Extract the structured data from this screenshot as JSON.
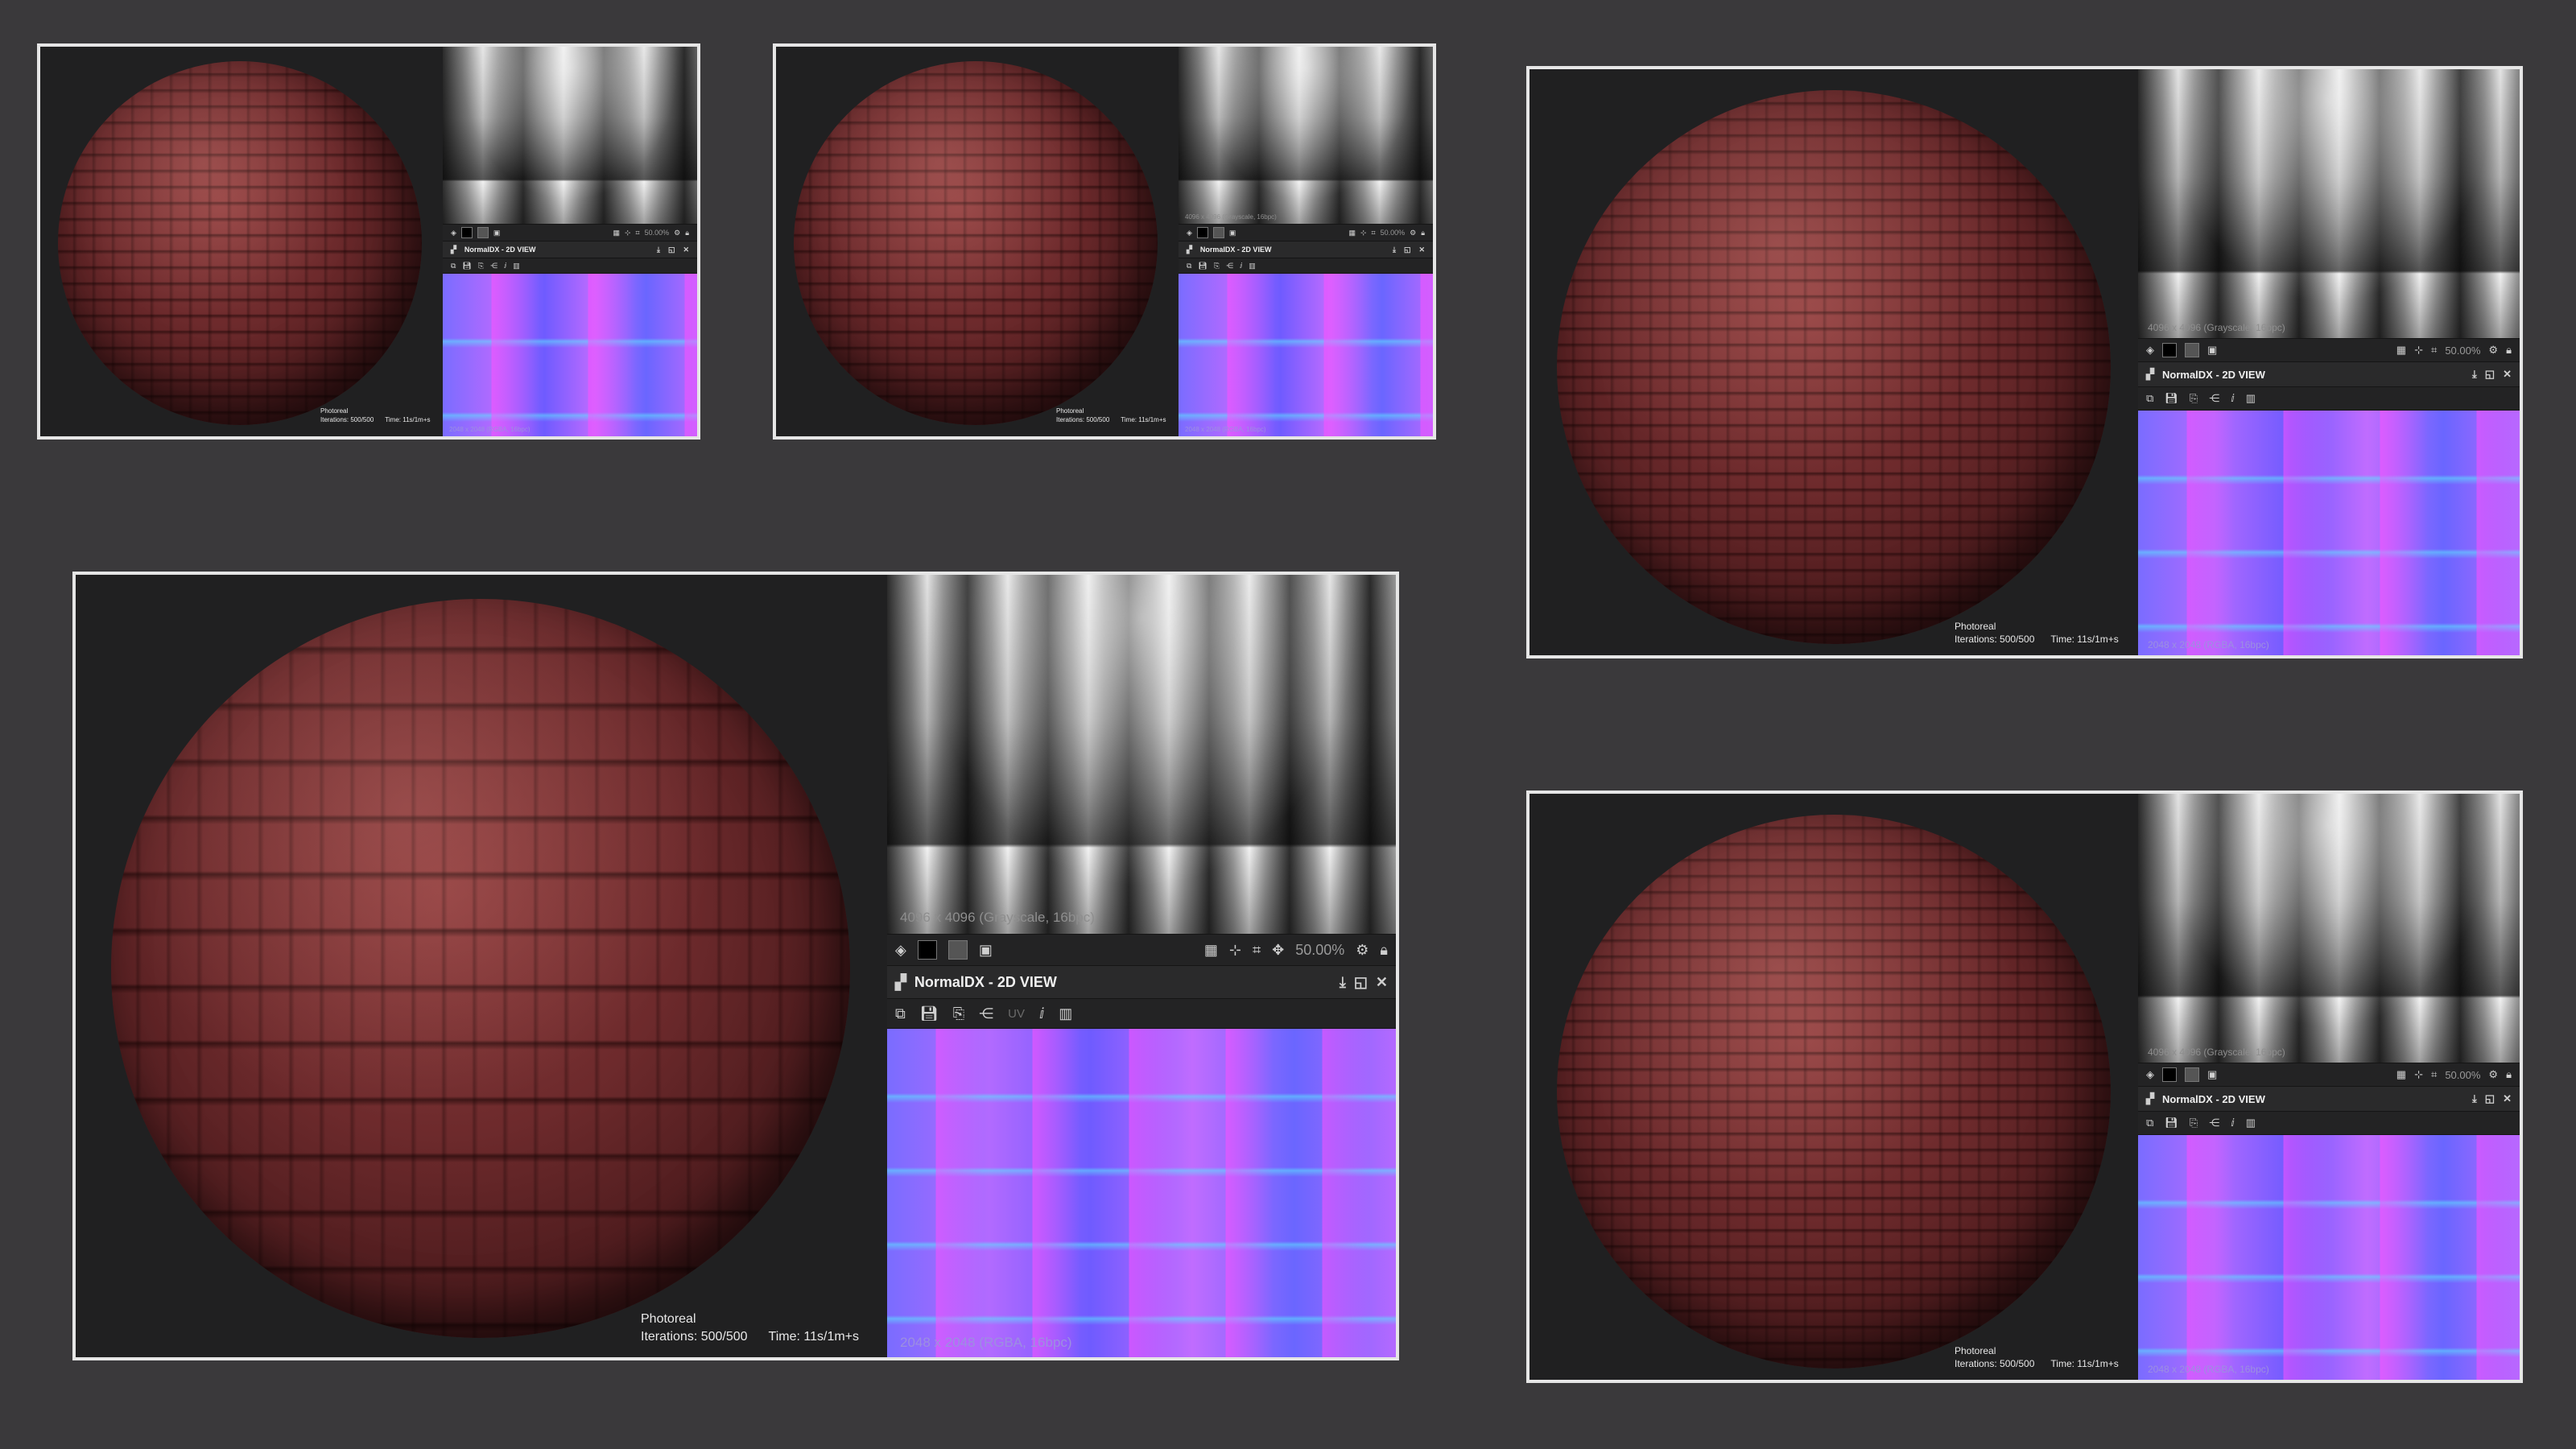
{
  "panels": [
    {
      "render": {
        "mode": "Photoreal",
        "iterations": "Iterations: 500/500",
        "time": "Time: 11s/1m+s"
      },
      "height_map": {
        "size": ""
      },
      "toolbar": {
        "zoom": "50.00%"
      },
      "normal_view": {
        "title": "NormalDX - 2D VIEW",
        "size": "2048 x 2048 (RGBA, 16bpc)"
      }
    },
    {
      "render": {
        "mode": "Photoreal",
        "iterations": "Iterations: 500/500",
        "time": "Time: 11s/1m+s"
      },
      "height_map": {
        "size": "4096 x 4096 (Grayscale, 16bpc)"
      },
      "toolbar": {
        "zoom": "50.00%"
      },
      "normal_view": {
        "title": "NormalDX - 2D VIEW",
        "size": "2048 x 2048 (RGBA, 16bpc)"
      }
    },
    {
      "render": {
        "mode": "Photoreal",
        "iterations": "Iterations: 500/500",
        "time": "Time: 11s/1m+s"
      },
      "height_map": {
        "size": "4096 x 4096 (Grayscale, 16bpc)"
      },
      "toolbar": {
        "zoom": "50.00%"
      },
      "normal_view": {
        "title": "NormalDX - 2D VIEW",
        "size": "2048 x 2048 (RGBA, 16bpc)"
      }
    },
    {
      "render": {
        "mode": "Photoreal",
        "iterations": "Iterations: 500/500",
        "time": "Time: 11s/1m+s"
      },
      "height_map": {
        "size": "4096 x 4096 (Grayscale, 16bpc)"
      },
      "toolbar": {
        "zoom": "50.00%"
      },
      "normal_view": {
        "title": "NormalDX - 2D VIEW",
        "size": "2048 x 2048 (RGBA, 16bpc)",
        "uv_label": "UV"
      }
    },
    {
      "render": {
        "mode": "Photoreal",
        "iterations": "Iterations: 500/500",
        "time": "Time: 11s/1m+s"
      },
      "height_map": {
        "size": "4096 x 4096 (Grayscale, 16bpc)"
      },
      "toolbar": {
        "zoom": "50.00%"
      },
      "normal_view": {
        "title": "NormalDX - 2D VIEW",
        "size": "2048 x 2048 (RGBA, 16bpc)"
      }
    }
  ],
  "icons": {
    "layers": "layers-icon",
    "grid": "grid-icon",
    "pin": "pin-icon",
    "maximize": "maximize-icon",
    "close": "close-icon",
    "save": "save-icon",
    "info": "info-icon",
    "histogram": "histogram-icon"
  },
  "colors": {
    "background": "#3a393b",
    "panel_border": "#e6e6e6",
    "tile_red": "#6d2a2c"
  }
}
